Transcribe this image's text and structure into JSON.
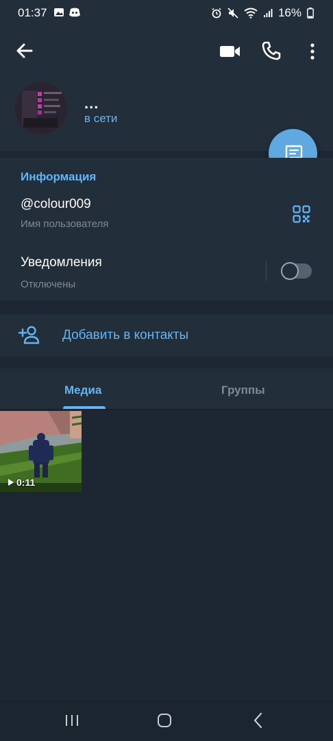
{
  "status_bar": {
    "time": "01:37",
    "battery": "16%"
  },
  "header": {
    "contact_name": "...",
    "contact_status": "в сети",
    "icons": {
      "back": "back-arrow-icon",
      "video": "video-camera-icon",
      "call": "phone-icon",
      "menu": "more-vertical-icon",
      "fab": "message-icon"
    }
  },
  "info": {
    "title": "Информация",
    "username": "@colour009",
    "username_label": "Имя пользователя",
    "notifications_label": "Уведомления",
    "notifications_value": "Отключены",
    "notifications_enabled": false
  },
  "add_contact": {
    "label": "Добавить в контакты"
  },
  "tabs": {
    "media": "Медиа",
    "groups": "Группы",
    "active": "media"
  },
  "media": {
    "items": [
      {
        "type": "video",
        "duration": "0:11"
      }
    ]
  },
  "colors": {
    "accent": "#64b5f6",
    "background": "#1d2733",
    "panel": "#222e3a",
    "fab": "#5fa8e0"
  }
}
